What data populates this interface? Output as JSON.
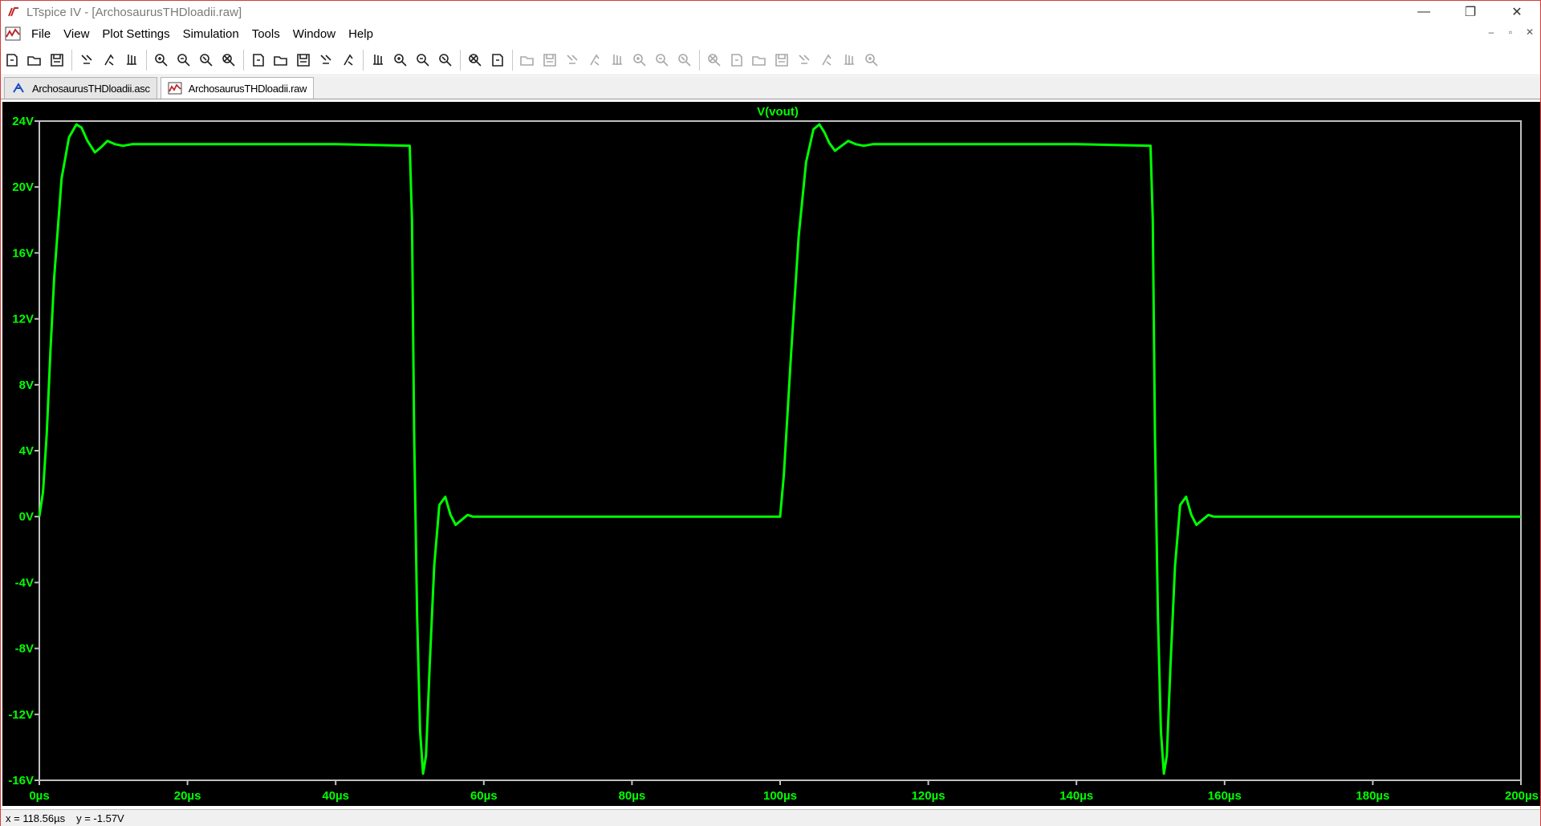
{
  "window": {
    "title": "LTspice IV - [ArchosaurusTHDloadii.raw]",
    "controls": [
      "—",
      "❐",
      "✕"
    ]
  },
  "menu": {
    "items": [
      {
        "label": "File"
      },
      {
        "label": "View"
      },
      {
        "label": "Plot Settings"
      },
      {
        "label": "Simulation"
      },
      {
        "label": "Tools"
      },
      {
        "label": "Window"
      },
      {
        "label": "Help"
      }
    ],
    "mdi_controls": [
      "–",
      "▫",
      "✕"
    ]
  },
  "toolbar": {
    "icons": [
      "new-schematic-icon",
      "open-icon",
      "save-icon",
      "control-panel-icon",
      "run-icon",
      "halt-icon",
      "zoom-in-icon",
      "zoom-out-icon",
      "zoom-back-icon",
      "zoom-extents-icon",
      "autorange-icon",
      "mark-icon",
      "tile-horizontal-icon",
      "cascade-icon",
      "tile-vertical-icon",
      "cut-icon",
      "copy-icon",
      "paste-icon",
      "find-icon",
      "print-preview-icon",
      "print-icon",
      "wire-icon",
      "ground-icon",
      "label-icon",
      "resistor-icon",
      "capacitor-icon",
      "inductor-icon",
      "diode-icon",
      "component-icon",
      "move-icon",
      "drag-icon",
      "undo-icon",
      "redo-icon",
      "rotate-icon",
      "mirror-icon",
      "text-icon",
      "spice-directive-icon"
    ]
  },
  "tabs": [
    {
      "label": "ArchosaurusTHDloadii.asc",
      "icon": "schematic-icon",
      "active": false
    },
    {
      "label": "ArchosaurusTHDloadii.raw",
      "icon": "waveform-icon",
      "active": true
    }
  ],
  "status": {
    "x_readout": "x = 118.56µs",
    "y_readout": "y = -1.57V"
  },
  "colors": {
    "trace": "#00ff00",
    "plot_bg": "#000000",
    "axis": "#c0c0c0",
    "tick_label": "#00ff00"
  },
  "chart_data": {
    "type": "line",
    "title": "V(vout)",
    "xlabel": "",
    "ylabel": "",
    "x_unit": "µs",
    "y_unit": "V",
    "xlim": [
      0,
      200
    ],
    "ylim": [
      -16,
      24
    ],
    "x_ticks": [
      "0µs",
      "20µs",
      "40µs",
      "60µs",
      "80µs",
      "100µs",
      "120µs",
      "140µs",
      "160µs",
      "180µs",
      "200µs"
    ],
    "y_ticks": [
      "24V",
      "20V",
      "16V",
      "12V",
      "8V",
      "4V",
      "0V",
      "-4V",
      "-8V",
      "-12V",
      "-16V"
    ],
    "series": [
      {
        "name": "V(vout)",
        "color": "#00ff00",
        "x": [
          0,
          0.5,
          1,
          1.5,
          2,
          3,
          4,
          5,
          5.7,
          6.5,
          7.5,
          8.3,
          9.2,
          10.2,
          11.3,
          12.5,
          15,
          30,
          40,
          50,
          50.3,
          50.6,
          51,
          51.4,
          51.8,
          52.2,
          52.7,
          53.3,
          54,
          54.8,
          55.5,
          56.2,
          57,
          57.8,
          58.5,
          60,
          80,
          100,
          100.5,
          101.5,
          102.5,
          103.5,
          104.5,
          105.3,
          106,
          106.6,
          107.4,
          108.3,
          109.2,
          110.2,
          111.3,
          112.5,
          115,
          130,
          140,
          150,
          150.3,
          150.6,
          151,
          151.4,
          151.8,
          152.2,
          152.7,
          153.3,
          154,
          154.8,
          155.5,
          156.2,
          157,
          157.8,
          158.5,
          160,
          180,
          200
        ],
        "y": [
          0,
          1.5,
          5,
          10,
          14.5,
          20.5,
          23,
          23.8,
          23.6,
          22.8,
          22.1,
          22.4,
          22.8,
          22.6,
          22.5,
          22.6,
          22.6,
          22.6,
          22.6,
          22.5,
          18,
          5,
          -6,
          -13,
          -15.6,
          -14.5,
          -9,
          -3,
          0.7,
          1.2,
          0.1,
          -0.5,
          -0.2,
          0.1,
          0,
          0,
          0,
          0,
          2.5,
          10,
          17,
          21.5,
          23.5,
          23.8,
          23.3,
          22.7,
          22.2,
          22.5,
          22.8,
          22.6,
          22.5,
          22.6,
          22.6,
          22.6,
          22.6,
          22.5,
          18,
          5,
          -6,
          -13,
          -15.6,
          -14.5,
          -9,
          -3,
          0.7,
          1.2,
          0.1,
          -0.5,
          -0.2,
          0.1,
          0,
          0,
          0,
          0
        ]
      }
    ]
  }
}
